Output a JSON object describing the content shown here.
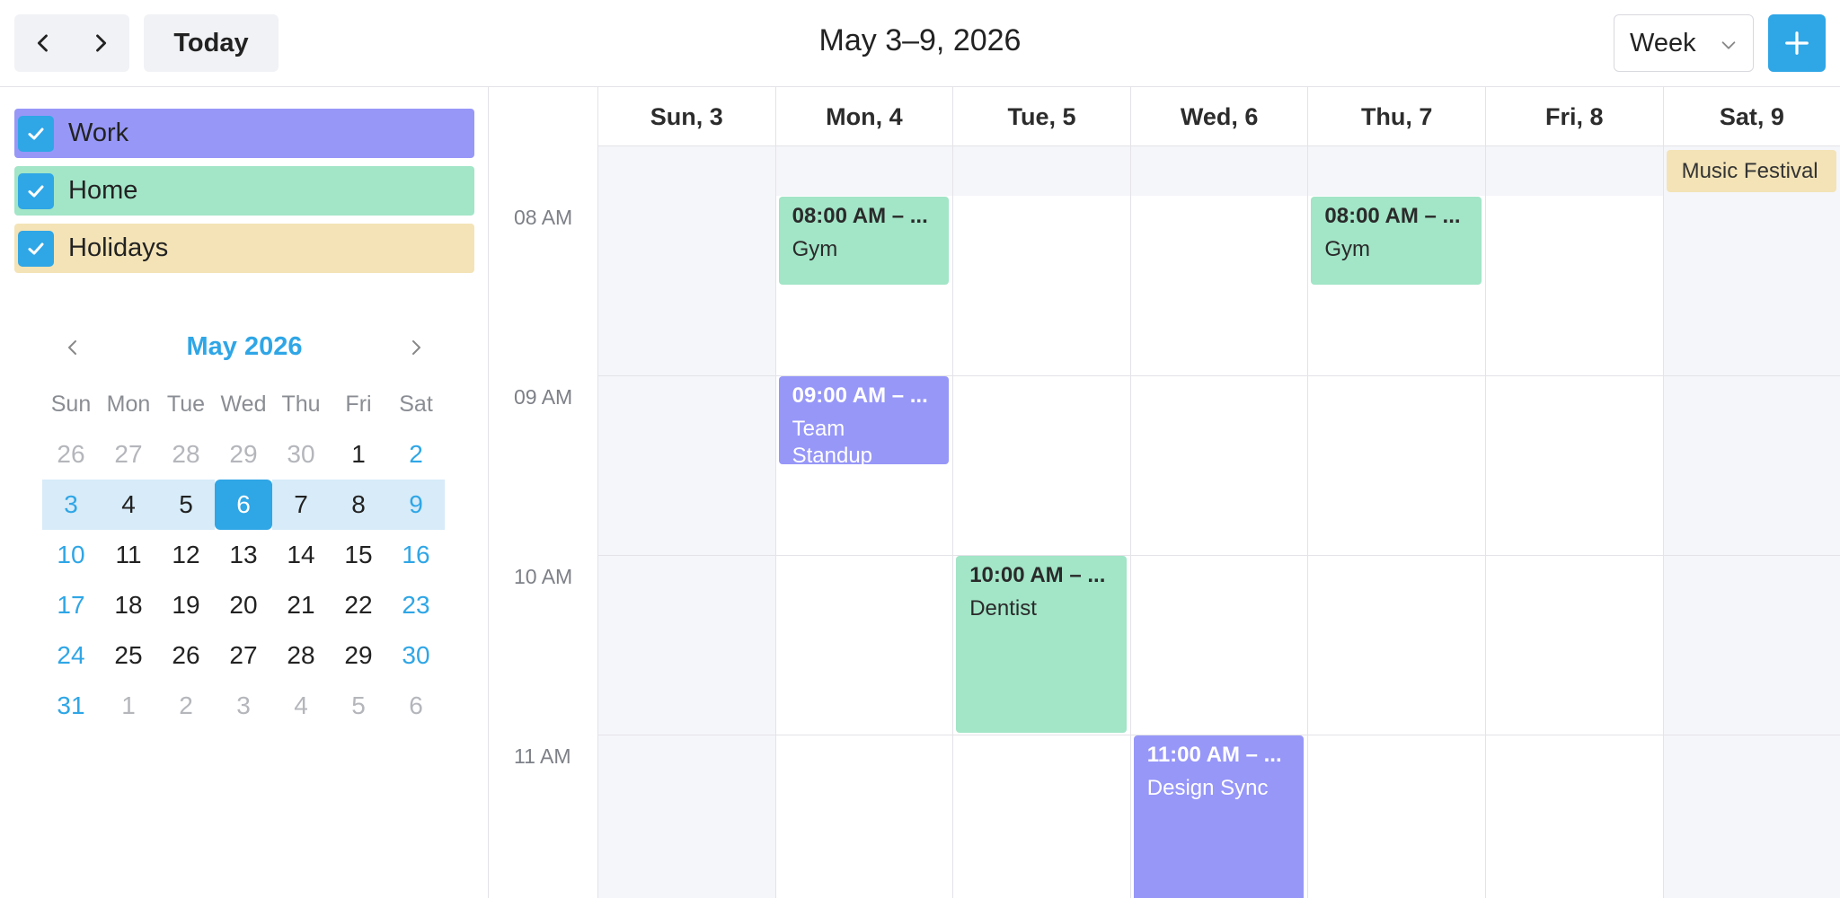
{
  "toolbar": {
    "prev_icon": "chevron-left",
    "next_icon": "chevron-right",
    "today_label": "Today",
    "range_title": "May 3–9, 2026",
    "view_value": "Week",
    "add_icon": "plus"
  },
  "calendars": [
    {
      "label": "Work",
      "color": "#9797f8",
      "checked": true
    },
    {
      "label": "Home",
      "color": "#a2e5c7",
      "checked": true
    },
    {
      "label": "Holidays",
      "color": "#f3e3b6",
      "checked": true
    }
  ],
  "mini_calendar": {
    "title": "May 2026",
    "weekdays": [
      "Sun",
      "Mon",
      "Tue",
      "Wed",
      "Thu",
      "Fri",
      "Sat"
    ],
    "weeks": [
      [
        "26",
        "27",
        "28",
        "29",
        "30",
        "1",
        "2"
      ],
      [
        "3",
        "4",
        "5",
        "6",
        "7",
        "8",
        "9"
      ],
      [
        "10",
        "11",
        "12",
        "13",
        "14",
        "15",
        "16"
      ],
      [
        "17",
        "18",
        "19",
        "20",
        "21",
        "22",
        "23"
      ],
      [
        "24",
        "25",
        "26",
        "27",
        "28",
        "29",
        "30"
      ],
      [
        "31",
        "1",
        "2",
        "3",
        "4",
        "5",
        "6"
      ]
    ],
    "selected_day": "6",
    "current_week_row": 1
  },
  "week": {
    "days": [
      "Sun, 3",
      "Mon, 4",
      "Tue, 5",
      "Wed, 6",
      "Thu, 7",
      "Fri, 8",
      "Sat, 9"
    ],
    "hours": [
      "08 AM",
      "09 AM",
      "10 AM",
      "11 AM"
    ]
  },
  "all_day_events": [
    {
      "title": "Music Festival",
      "calendar": "Holidays",
      "day": "Sat, 9"
    }
  ],
  "events": [
    {
      "time": "08:00 AM – ...",
      "title": "Gym",
      "calendar": "Home",
      "day": "Mon, 4"
    },
    {
      "time": "08:00 AM – ...",
      "title": "Gym",
      "calendar": "Home",
      "day": "Thu, 7"
    },
    {
      "time": "09:00 AM – ...",
      "title": "Team Standup",
      "calendar": "Work",
      "day": "Mon, 4"
    },
    {
      "time": "10:00 AM – ...",
      "title": "Dentist",
      "calendar": "Home",
      "day": "Tue, 5"
    },
    {
      "time": "11:00 AM – ...",
      "title": "Design Sync",
      "calendar": "Work",
      "day": "Wed, 6"
    }
  ]
}
